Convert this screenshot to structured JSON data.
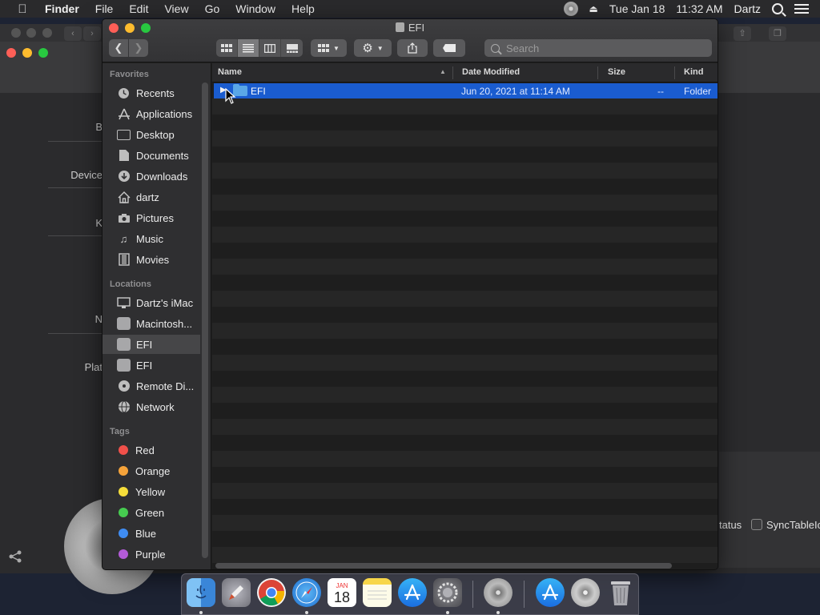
{
  "menubar": {
    "app": "Finder",
    "menus": [
      "File",
      "Edit",
      "View",
      "Go",
      "Window",
      "Help"
    ],
    "date": "Tue Jan 18",
    "time": "11:32 AM",
    "user": "Dartz",
    "icons": [
      "apple-icon",
      "disc-icon",
      "eject-icon",
      "spotlight-icon",
      "control-center-icon"
    ]
  },
  "background_window": {
    "labels": [
      "B",
      "Device",
      "K",
      "N",
      "Plat"
    ],
    "status_text": "tatus",
    "checkbox_label": "SyncTableIc"
  },
  "finder": {
    "title": "EFI",
    "search_placeholder": "Search",
    "sidebar": {
      "favorites_header": "Favorites",
      "favorites": [
        {
          "label": "Recents",
          "icon": "clock-icon"
        },
        {
          "label": "Applications",
          "icon": "applications-icon"
        },
        {
          "label": "Desktop",
          "icon": "desktop-icon"
        },
        {
          "label": "Documents",
          "icon": "document-icon"
        },
        {
          "label": "Downloads",
          "icon": "download-icon"
        },
        {
          "label": "dartz",
          "icon": "home-icon"
        },
        {
          "label": "Pictures",
          "icon": "camera-icon"
        },
        {
          "label": "Music",
          "icon": "music-note-icon"
        },
        {
          "label": "Movies",
          "icon": "film-icon"
        }
      ],
      "locations_header": "Locations",
      "locations": [
        {
          "label": "Dartz's iMac",
          "icon": "imac-icon"
        },
        {
          "label": "Macintosh...",
          "icon": "disk-icon"
        },
        {
          "label": "EFI",
          "icon": "disk-icon",
          "selected": true
        },
        {
          "label": "EFI",
          "icon": "disk-icon"
        },
        {
          "label": "Remote Di...",
          "icon": "optical-disc-icon"
        },
        {
          "label": "Network",
          "icon": "globe-icon"
        }
      ],
      "tags_header": "Tags",
      "tags": [
        {
          "label": "Red",
          "color": "#f0504a"
        },
        {
          "label": "Orange",
          "color": "#f5a33a"
        },
        {
          "label": "Yellow",
          "color": "#f5dd3a"
        },
        {
          "label": "Green",
          "color": "#46cc50"
        },
        {
          "label": "Blue",
          "color": "#3f8cf2"
        },
        {
          "label": "Purple",
          "color": "#b35bd8"
        }
      ]
    },
    "columns": {
      "name": "Name",
      "date": "Date Modified",
      "size": "Size",
      "kind": "Kind"
    },
    "rows": [
      {
        "name": "EFI",
        "date": "Jun 20, 2021 at 11:14 AM",
        "size": "--",
        "kind": "Folder",
        "selected": true
      }
    ]
  },
  "dock": {
    "apps": [
      "finder-icon",
      "launchpad-icon",
      "chrome-icon",
      "safari-icon",
      "calendar-icon",
      "notes-icon",
      "app-store-icon",
      "system-preferences-icon",
      "disk-utility-icon",
      "app-store-downloads-icon",
      "optical-drive-icon",
      "trash-icon"
    ],
    "calendar_month": "JAN",
    "calendar_day": "18"
  },
  "colors": {
    "selection": "#1a5ccf",
    "menubar": "#2a2a2c",
    "sidebar": "#2f2f31"
  }
}
